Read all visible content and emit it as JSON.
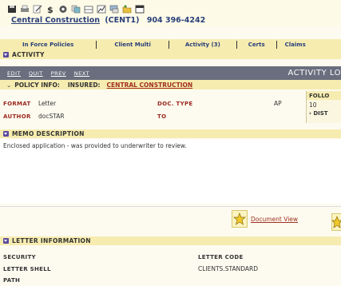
{
  "toolbar": {
    "icons": [
      "save-icon",
      "print-icon",
      "edit-icon",
      "dollar-icon",
      "settings-icon",
      "copy-icon",
      "inbox-icon",
      "chart-icon",
      "message-icon",
      "folder-icon",
      "calendar-icon"
    ],
    "client_name": "Central Construction",
    "client_code": "(CENT1)",
    "client_phone": "904 396-4242"
  },
  "nav": {
    "tabs": [
      "In Force Policies",
      "Client Multi",
      "Activity (3)",
      "Certs",
      "Claims"
    ]
  },
  "sections": {
    "activity": "Activity",
    "policy_info": "Policy Info:",
    "insured_label": "Insured:",
    "insured_name": "Central Construction",
    "memo": "Memo Description",
    "letter_info": "Letter Information"
  },
  "actions": {
    "edit": "Edit",
    "quit": "Quit",
    "prev": "Prev",
    "next": "Next",
    "log_title": "Activity Lo"
  },
  "fields": {
    "format_label": "Format",
    "format_value": "Letter",
    "author_label": "Author",
    "author_value": "docSTAR",
    "doc_type_label": "Doc. Type",
    "doc_type_value": "AP",
    "to_label": "To"
  },
  "follow": {
    "label": "Follo",
    "value": "10",
    "dist": "Dist"
  },
  "memo_text": "Enclosed application - was provided to underwriter to review.",
  "document_view": "Document View",
  "letter": {
    "security_label": "Security",
    "letter_code_label": "Letter Code",
    "letter_shell_label": "Letter Shell",
    "letter_shell_value": "CLIENTS.STANDARD",
    "path_label": "Path"
  }
}
